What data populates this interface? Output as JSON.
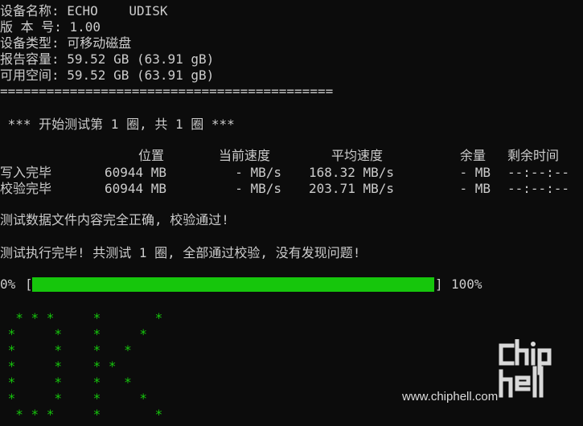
{
  "device": {
    "name_line": "设备名称: ECHO    UDISK",
    "version_line": "版 本 号: 1.00",
    "type_line": "设备类型: 可移动磁盘",
    "reported_line": "报告容量: 59.52 GB (63.91 gB)",
    "available_line": "可用空间: 59.52 GB (63.91 gB)"
  },
  "separator": "===========================================",
  "test_start": " *** 开始测试第 1 圈, 共 1 圈 ***",
  "table": {
    "headers": {
      "position": "位置",
      "current_speed": "当前速度",
      "avg_speed": "平均速度",
      "remaining": "余量",
      "time_left": "剩余时间"
    },
    "rows": [
      {
        "label": "写入完毕",
        "position": "60944 MB",
        "current_speed": "- MB/s",
        "avg_speed": "168.32 MB/s",
        "remaining": "- MB",
        "time_left": "--:--:--"
      },
      {
        "label": "校验完毕",
        "position": "60944 MB",
        "current_speed": "- MB/s",
        "avg_speed": "203.71 MB/s",
        "remaining": "- MB",
        "time_left": "--:--:--"
      }
    ]
  },
  "msg_verify": "测试数据文件内容完全正确, 校验通过!",
  "msg_done": "测试执行完毕! 共测试 1 圈, 全部通过校验, 没有发现问题!",
  "progress": {
    "left_label": "0%",
    "open_bracket": "[",
    "close_bracket": "]",
    "right_label": "100%",
    "fraction": 1.0,
    "color": "#16c60c"
  },
  "ok_art": "  * * *     *       *\n *     *    *     *\n *     *    *   *\n *     *    * *\n *     *    *   *\n *     *    *     *\n  * * *     *       *",
  "watermark": {
    "url": "www.chiphell.com",
    "logo_text": "chiphell"
  },
  "colors": {
    "background": "#0c0c0c",
    "text": "#cccccc",
    "green": "#16c60c"
  }
}
